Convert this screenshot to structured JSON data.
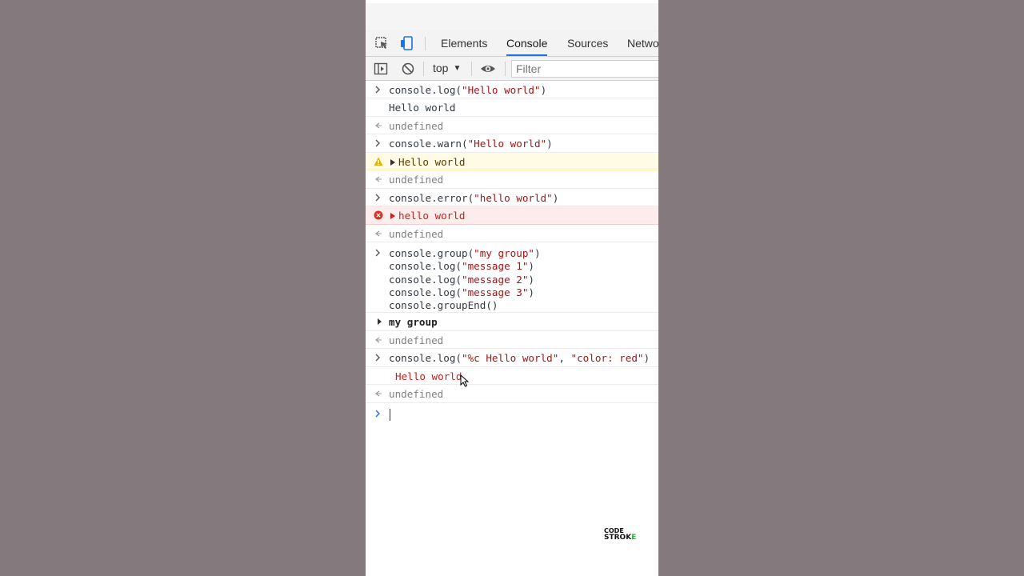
{
  "tabs": {
    "items": [
      "Elements",
      "Console",
      "Sources",
      "Netwo"
    ],
    "active_index": 1
  },
  "toolbar": {
    "context": "top",
    "filter_placeholder": "Filter"
  },
  "console": {
    "entries": [
      {
        "type": "input",
        "code": "console.log(\"Hello world\")"
      },
      {
        "type": "log",
        "text": "Hello world"
      },
      {
        "type": "return",
        "text": "undefined"
      },
      {
        "type": "input",
        "code": "console.warn(\"Hello world\")"
      },
      {
        "type": "warn",
        "text": "Hello world"
      },
      {
        "type": "return",
        "text": "undefined"
      },
      {
        "type": "input",
        "code": "console.error(\"hello world\")"
      },
      {
        "type": "error",
        "text": "hello world"
      },
      {
        "type": "return",
        "text": "undefined"
      },
      {
        "type": "input-multi",
        "lines": [
          "console.group(\"my group\")",
          "console.log(\"message 1\")",
          "console.log(\"message 2\")",
          "console.log(\"message 3\")",
          "console.groupEnd()"
        ]
      },
      {
        "type": "group",
        "text": "my group"
      },
      {
        "type": "return",
        "text": "undefined"
      },
      {
        "type": "input",
        "code": "console.log(\"%c Hello world\", \"color: red\")"
      },
      {
        "type": "styled-log",
        "text": "Hello world"
      },
      {
        "type": "return",
        "text": "undefined"
      }
    ]
  },
  "logo": {
    "line1": "CODE",
    "line2a": "STROK",
    "line2b": "E"
  },
  "colors": {
    "background": "#847a7e",
    "panel": "#ffffff",
    "accent": "#1a73e8",
    "string": "#a31515",
    "error": "#c5221f",
    "warning_bg": "#fffbe5",
    "error_bg": "#fdecec"
  }
}
